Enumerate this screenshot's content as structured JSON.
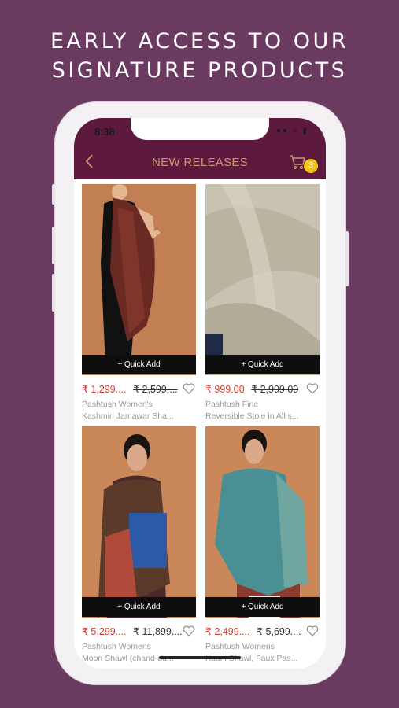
{
  "promo": {
    "line1": "EARLY ACCESS TO OUR",
    "line2": "SIGNATURE PRODUCTS"
  },
  "status": {
    "time": "8:38",
    "icons": "●● ≡ ▮"
  },
  "header": {
    "title": "NEW RELEASES",
    "cart_count": "3",
    "back_icon": "chevron-left-icon",
    "cart_icon": "cart-icon"
  },
  "colors": {
    "background": "#6b3a60",
    "appbar": "#5e1a3e",
    "accent": "#c49a6c",
    "price": "#d33a2c",
    "badge": "#f5c518"
  },
  "products": [
    {
      "quick_add": "+ Quick Add",
      "price": "₹ 1,299....",
      "mrp": "₹ 2,599....",
      "name1": "Pashtush Women's",
      "name2": "Kashmiri Jamawar Sha..."
    },
    {
      "quick_add": "+ Quick Add",
      "price": "₹ 999.00",
      "mrp": "₹ 2,999.00",
      "name1": "Pashtush Fine",
      "name2": "Reversible Stole in All s..."
    },
    {
      "quick_add": "+ Quick Add",
      "price": "₹ 5,299....",
      "mrp": "₹ 11,899....",
      "name1": "Pashtush Womens",
      "name2": "Moon Shawl (chand-da..."
    },
    {
      "quick_add": "+ Quick Add",
      "price": "₹ 2,499....",
      "mrp": "₹ 5,699....",
      "name1": "Pashtush Womens",
      "name2": "Kaani Shawl, Faux Pas..."
    }
  ]
}
